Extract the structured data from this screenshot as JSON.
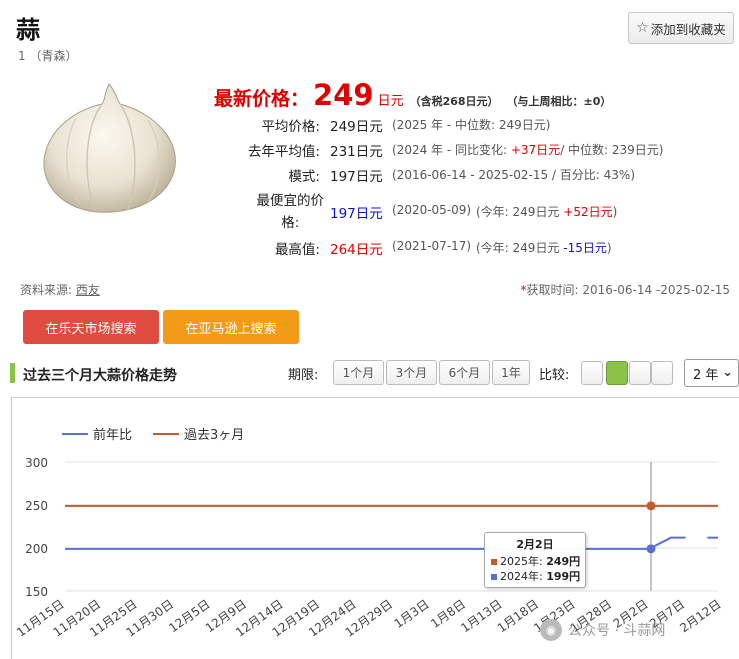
{
  "header": {
    "title": "蒜",
    "subtitle": "1 （青森）",
    "favorite_label": "添加到收藏夹"
  },
  "price": {
    "latest_label": "最新价格：",
    "latest_value": "249",
    "latest_unit": "日元",
    "tax_note": "（含税268日元）",
    "weekly_compare": "（与上周相比：±0）"
  },
  "stats": {
    "average": {
      "label": "平均价格:",
      "value": "249日元",
      "detail": "(2025 年 - 中位数: 249日元)"
    },
    "last_year": {
      "label": "去年平均值:",
      "value": "231日元",
      "detail_prefix": "(2024 年 - 同比变化: ",
      "detail_change": "+37日元",
      "detail_suffix": "/ 中位数: 239日元)"
    },
    "mode": {
      "label": "模式:",
      "value": "197日元",
      "detail": "(2016-06-14 - 2025-02-15 / 百分比: 43%)"
    },
    "cheapest": {
      "label_line1": "最便宜的价",
      "label_line2": "格:",
      "value": "197日元",
      "detail": "(2020-05-09)",
      "current_prefix": "(今年: 249日元 ",
      "current_change": "+52日元",
      "current_suffix": ")"
    },
    "highest": {
      "label": "最高值:",
      "value": "264日元",
      "detail": "(2021-07-17)",
      "current_prefix": "(今年: 249日元 ",
      "current_change": "-15日元",
      "current_suffix": ")"
    }
  },
  "source": {
    "label": "资料来源:",
    "link": "西友"
  },
  "fetch": {
    "asterisk": "*",
    "label": "获取时间: 2016-06-14 -2025-02-15"
  },
  "actions": {
    "rakuten": "在乐天市场搜索",
    "amazon": "在亚马逊上搜索"
  },
  "section": {
    "title": "过去三个月大蒜价格走势"
  },
  "controls": {
    "period_label": "期限:",
    "periods": [
      "1个月",
      "3个月",
      "6个月",
      "1年"
    ],
    "compare_label": "比较:",
    "select_value": "2 年"
  },
  "colors": {
    "series_prev_year": "#5b6fd6",
    "series_recent": "#c8582e",
    "accent_green": "#8bc34a",
    "price_red": "#e00000"
  },
  "chart_data": {
    "type": "line",
    "title": "",
    "xlabel": "",
    "ylabel": "",
    "ylim": [
      150,
      300
    ],
    "yticks": [
      150,
      200,
      250,
      300
    ],
    "x_tick_labels": [
      "11月15日",
      "11月20日",
      "11月25日",
      "11月30日",
      "12月5日",
      "12月9日",
      "12月14日",
      "12月19日",
      "12月24日",
      "12月29日",
      "1月3日",
      "1月8日",
      "1月13日",
      "1月18日",
      "1月23日",
      "1月28日",
      "2月2日",
      "2月7日",
      "2月12日"
    ],
    "legend": {
      "position": "top-left"
    },
    "grid": true,
    "series": [
      {
        "name": "前年比",
        "points": [
          [
            "11月15日",
            199
          ],
          [
            "2月2日",
            199
          ],
          [
            "2月5日",
            212
          ],
          [
            "2月7日",
            212
          ],
          [
            "2月10日",
            212
          ],
          [
            "2月14日",
            212
          ]
        ]
      },
      {
        "name": "過去3ヶ月",
        "points": [
          [
            "11月15日",
            249
          ],
          [
            "2月14日",
            249
          ]
        ]
      }
    ],
    "tooltip": {
      "date": "2月2日",
      "rows": [
        {
          "label": "2025年:",
          "value": "249円"
        },
        {
          "label": "2024年:",
          "value": "199円"
        }
      ]
    }
  },
  "watermark": {
    "text": "公众号 · 斗蒜网"
  }
}
